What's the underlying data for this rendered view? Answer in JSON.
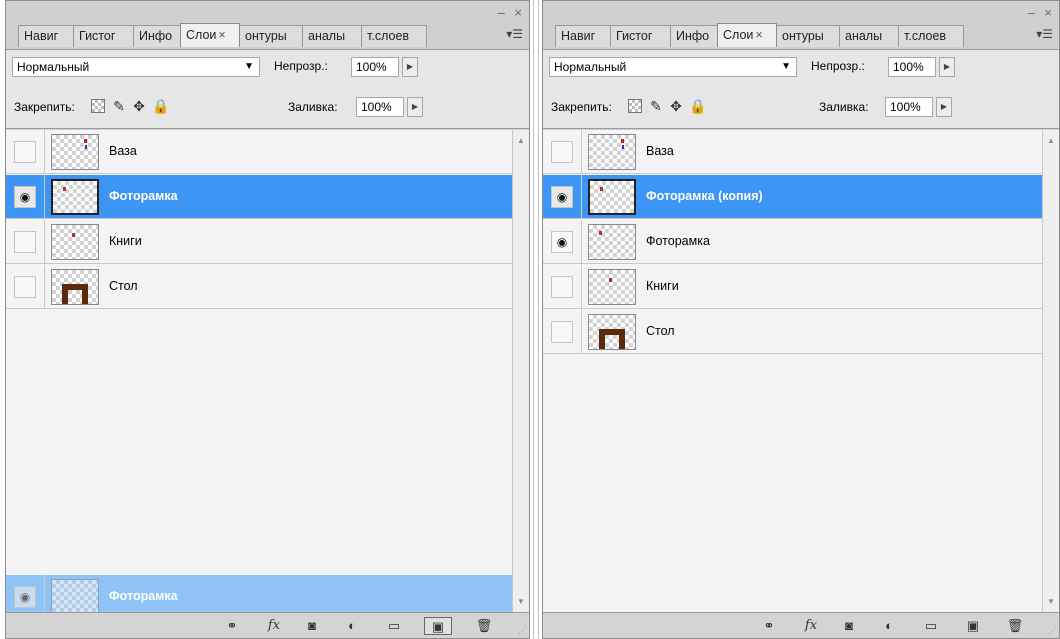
{
  "panels": [
    {
      "tabs": [
        {
          "label": "Навиг"
        },
        {
          "label": "Гистог"
        },
        {
          "label": "Инфо"
        },
        {
          "label": "Слои",
          "close": "×"
        },
        {
          "label": "онтуры"
        },
        {
          "label": "аналы"
        },
        {
          "label": "т.слоев"
        }
      ],
      "blend_mode": "Нормальный",
      "opacity_label": "Непрозр.:",
      "opacity_value": "100%",
      "lock_label": "Закрепить:",
      "fill_label": "Заливка:",
      "fill_value": "100%",
      "layers": [
        {
          "name": "Ваза",
          "visible": false,
          "state": "normal"
        },
        {
          "name": "Фоторамка",
          "visible": true,
          "state": "selected"
        },
        {
          "name": "Книги",
          "visible": false,
          "state": "normal"
        },
        {
          "name": "Стол",
          "visible": false,
          "state": "normal"
        }
      ],
      "drag_ghost": {
        "name": "Фоторамка"
      }
    },
    {
      "tabs": [
        {
          "label": "Навиг"
        },
        {
          "label": "Гистог"
        },
        {
          "label": "Инфо"
        },
        {
          "label": "Слои",
          "close": "×"
        },
        {
          "label": "онтуры"
        },
        {
          "label": "аналы"
        },
        {
          "label": "т.слоев"
        }
      ],
      "blend_mode": "Нормальный",
      "opacity_label": "Непрозр.:",
      "opacity_value": "100%",
      "lock_label": "Закрепить:",
      "fill_label": "Заливка:",
      "fill_value": "100%",
      "layers": [
        {
          "name": "Ваза",
          "visible": false,
          "state": "normal"
        },
        {
          "name": "Фоторамка (копия)",
          "visible": true,
          "state": "selected"
        },
        {
          "name": "Фоторамка",
          "visible": true,
          "state": "normal"
        },
        {
          "name": "Книги",
          "visible": false,
          "state": "normal"
        },
        {
          "name": "Стол",
          "visible": false,
          "state": "normal"
        }
      ]
    }
  ],
  "icons": {
    "eye": "eye-icon",
    "lock_transparency": "lock-transparency-icon",
    "lock_image": "brush-icon",
    "lock_position": "move-icon",
    "lock_all": "lock-icon",
    "link": "link-layers-icon",
    "fx": "fx",
    "mask": "add-mask-icon",
    "adjustment": "adjustment-layer-icon",
    "group": "folder-icon",
    "new_layer": "new-layer-icon",
    "trash": "trash-icon"
  },
  "colors": {
    "selection": "#3d95f5",
    "drag_ghost": "#8fc2f5",
    "panel_bg": "#d4d4d4"
  }
}
